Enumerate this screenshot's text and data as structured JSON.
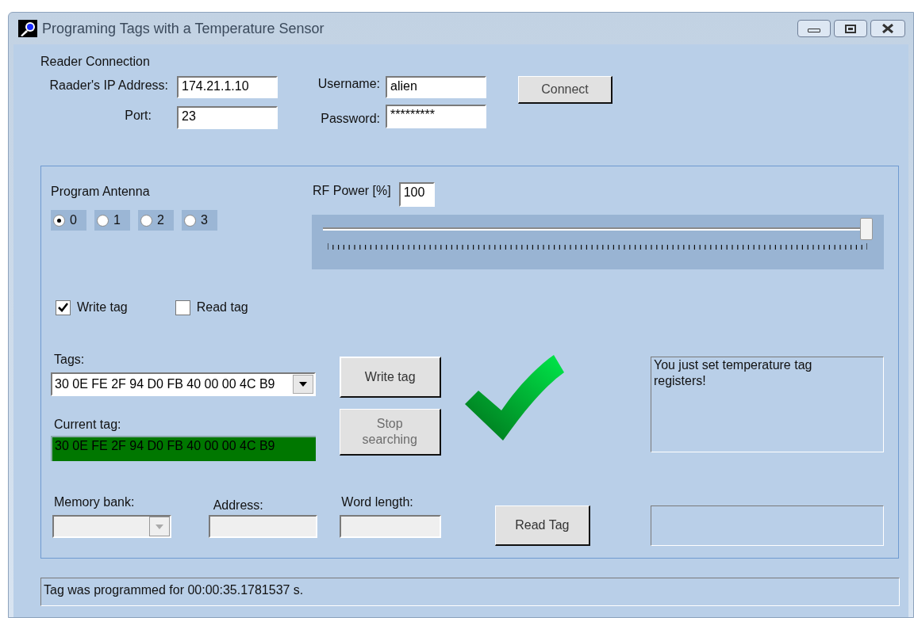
{
  "window": {
    "title": "Programing Tags with a Temperature Sensor"
  },
  "connection": {
    "title": "Reader Connection",
    "fields": [
      {
        "label": "Raader's IP Address:",
        "value": "174.21.1.10"
      },
      {
        "label": "Port:",
        "value": "23"
      },
      {
        "label": "Username:",
        "value": "alien"
      },
      {
        "label": "Password:",
        "value": "*********"
      }
    ],
    "connect_button": "Connect"
  },
  "antenna": {
    "title": "Program Antenna",
    "options": [
      {
        "label": "0",
        "selected": true
      },
      {
        "label": "1",
        "selected": false
      },
      {
        "label": "2",
        "selected": false
      },
      {
        "label": "3",
        "selected": false
      }
    ]
  },
  "rf_power": {
    "label": "RF Power [%]",
    "value": "100",
    "level": 1
  },
  "modes": [
    {
      "label": "Write tag",
      "checked": true
    },
    {
      "label": "Read tag",
      "checked": false
    }
  ],
  "tags": {
    "label": "Tags:",
    "value": "30 0E FE 2F 94 D0 FB 40 00 00 4C B9"
  },
  "current_tag": {
    "label": "Current tag:",
    "value": "30 0E FE 2F 94 D0 FB 40 00 00 4C B9"
  },
  "write_button": {
    "label": "Write tag",
    "disabled": false
  },
  "stop_button": {
    "label": "Stop searching",
    "disabled": true
  },
  "read_button": {
    "label": "Read Tag",
    "disabled": false
  },
  "memory": [
    {
      "label": "Memory bank:",
      "kind": "dropdown",
      "disabled": true
    },
    {
      "label": "Address:",
      "kind": "text",
      "disabled": true
    },
    {
      "label": "Word length:",
      "kind": "text",
      "disabled": true
    }
  ],
  "result": {
    "success": true,
    "message": "You just set temperature tag registers!"
  },
  "status_bar": "Tag was programmed for 00:00:35.1781537 s."
}
